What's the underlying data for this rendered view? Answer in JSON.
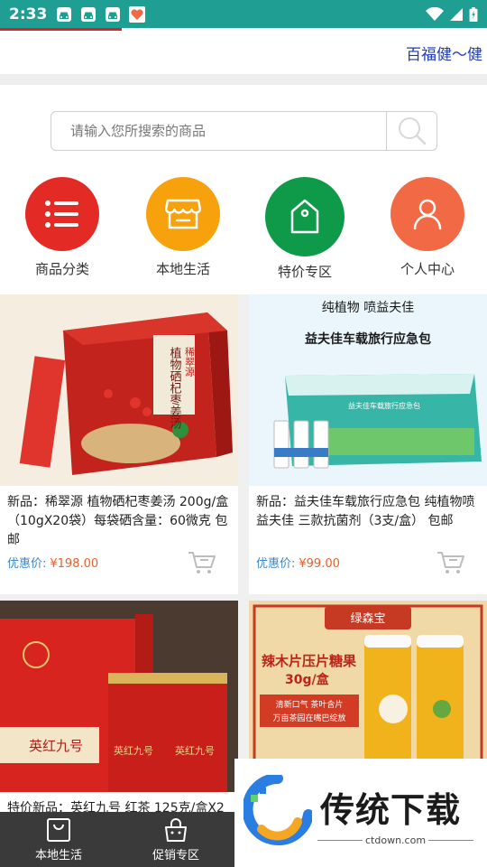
{
  "status_bar": {
    "time": "2:33",
    "background": "#1f9e94",
    "icons": [
      "car-app-icon",
      "car-app-icon",
      "car-app-icon",
      "health-app-icon",
      "wifi-icon",
      "signal-icon",
      "battery-icon"
    ]
  },
  "page_load_progress": 0.25,
  "marquee": {
    "text": "百福健～健"
  },
  "search": {
    "placeholder": "请输入您所搜索的商品",
    "value": ""
  },
  "nav": [
    {
      "label": "商品分类",
      "icon": "list-icon",
      "color": "#e32a24"
    },
    {
      "label": "本地生活",
      "icon": "store-icon",
      "color": "#f7a10d"
    },
    {
      "label": "特价专区",
      "icon": "price-tag-icon",
      "color": "#0f9a4a"
    },
    {
      "label": "个人中心",
      "icon": "user-icon",
      "color": "#f26a45"
    }
  ],
  "products": [
    {
      "title": "新品：稀翠源 植物硒杞枣姜汤 200g/盒（10gX20袋）每袋硒含量：60微克 包邮",
      "price_label": "优惠价:",
      "price": "¥198.00",
      "image_text": [
        "植物硒杞枣姜汤",
        "稀翠源"
      ]
    },
    {
      "title": "新品：益夫佳车载旅行应急包 纯植物喷益夫佳 三款抗菌剂（3支/盒） 包邮",
      "price_label": "优惠价:",
      "price": "¥99.00",
      "image_text": [
        "纯植物 喷益夫佳",
        "益夫佳车载旅行应急包",
        "益夫佳车载旅行应急包"
      ]
    },
    {
      "title": "特价新品：英红九号 红茶 125克/盒X2",
      "image_text": [
        "英红九号",
        "英红九号",
        "英红九号"
      ]
    },
    {
      "title": "",
      "image_text": [
        "绿森宝",
        "辣木片压片糖果",
        "30g/盒",
        "清新口气 茶叶含片",
        "万亩茶园在嘴巴绽放"
      ]
    }
  ],
  "bottom_tabs": [
    {
      "label": "本地生活",
      "icon": "bag-icon"
    },
    {
      "label": "促销专区",
      "icon": "basket-icon"
    }
  ],
  "watermark": {
    "brand": "传统下载",
    "url": "ctdown.com"
  }
}
